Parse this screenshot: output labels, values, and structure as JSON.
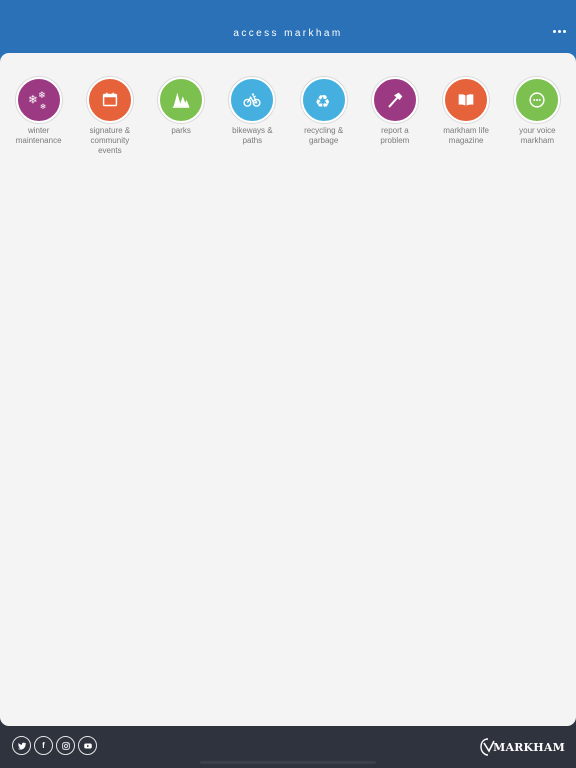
{
  "header": {
    "title": "access markham",
    "more_icon": "more-horizontal-icon"
  },
  "tiles": [
    {
      "label": "winter\nmaintenance",
      "icon": "snowflake-icon",
      "color": "#9b3a82"
    },
    {
      "label": "signature &\ncommunity\nevents",
      "icon": "calendar-icon",
      "color": "#e5623a"
    },
    {
      "label": "parks",
      "icon": "trees-icon",
      "color": "#7cc04f"
    },
    {
      "label": "bikeways &\npaths",
      "icon": "bicycle-icon",
      "color": "#45b0e0"
    },
    {
      "label": "recycling &\ngarbage",
      "icon": "recycle-icon",
      "color": "#45b0e0"
    },
    {
      "label": "report a\nproblem",
      "icon": "hammer-icon",
      "color": "#9b3a82"
    },
    {
      "label": "markham life\nmagazine",
      "icon": "book-icon",
      "color": "#e5623a"
    },
    {
      "label": "your voice\nmarkham",
      "icon": "speech-bubble-icon",
      "color": "#7cc04f"
    }
  ],
  "footer": {
    "social": [
      {
        "icon": "twitter-icon"
      },
      {
        "icon": "facebook-icon",
        "glyph": "f"
      },
      {
        "icon": "instagram-icon"
      },
      {
        "icon": "youtube-icon"
      }
    ],
    "logo_text": "MARKHAM"
  },
  "colors": {
    "header_bg": "#2a71b8",
    "footer_bg": "#2e333d",
    "main_bg": "#f4f4f4",
    "label_text": "#7a7a7a"
  }
}
